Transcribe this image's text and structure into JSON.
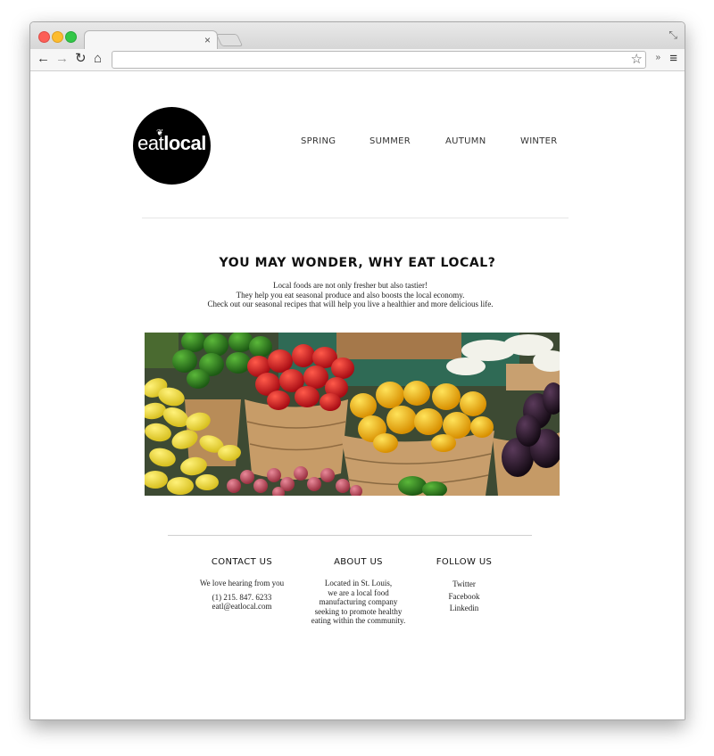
{
  "browser": {
    "tab_title": "",
    "tab_close": "×",
    "address": "",
    "icons": {
      "back": "←",
      "forward": "→",
      "reload": "↻",
      "home": "⌂",
      "star": "☆",
      "extensions": "»",
      "menu": "≡",
      "fullscreen": "⤡"
    }
  },
  "logo": {
    "thin": "eat",
    "bold": "local",
    "leaf": "❦"
  },
  "nav": {
    "spring": "SPRING",
    "summer": "SUMMER",
    "autumn": "AUTUMN",
    "winter": "WINTER"
  },
  "headline": "YOU MAY WONDER, WHY EAT LOCAL?",
  "intro": {
    "line1": "Local foods are not only fresher but also tastier!",
    "line2": "They help you eat seasonal produce and also boosts the local economy.",
    "line3": "Check out our seasonal recipes that will help you live a healthier and more delicious life."
  },
  "footer": {
    "contact": {
      "title": "CONTACT US",
      "line1": "We love hearing from you",
      "phone": "(1) 215. 847. 6233",
      "email": "eatl@eatlocal.com"
    },
    "about": {
      "title": "ABOUT US",
      "line1": "Located in St. Louis,",
      "line2": "we are a local food",
      "line3": "manufacturing company",
      "line4": "seeking to promote healthy",
      "line5": "eating within the community."
    },
    "follow": {
      "title": "FOLLOW US",
      "twitter": "Twitter",
      "facebook": "Facebook",
      "linkedin": "Linkedin"
    }
  },
  "colors": {
    "logo_bg": "#000000",
    "red_pepper": "#c8141c",
    "yellow_pepper": "#f2b705",
    "green_pepper": "#2f7a1f",
    "eggplant": "#2a1a2a",
    "basket": "#b89462"
  }
}
